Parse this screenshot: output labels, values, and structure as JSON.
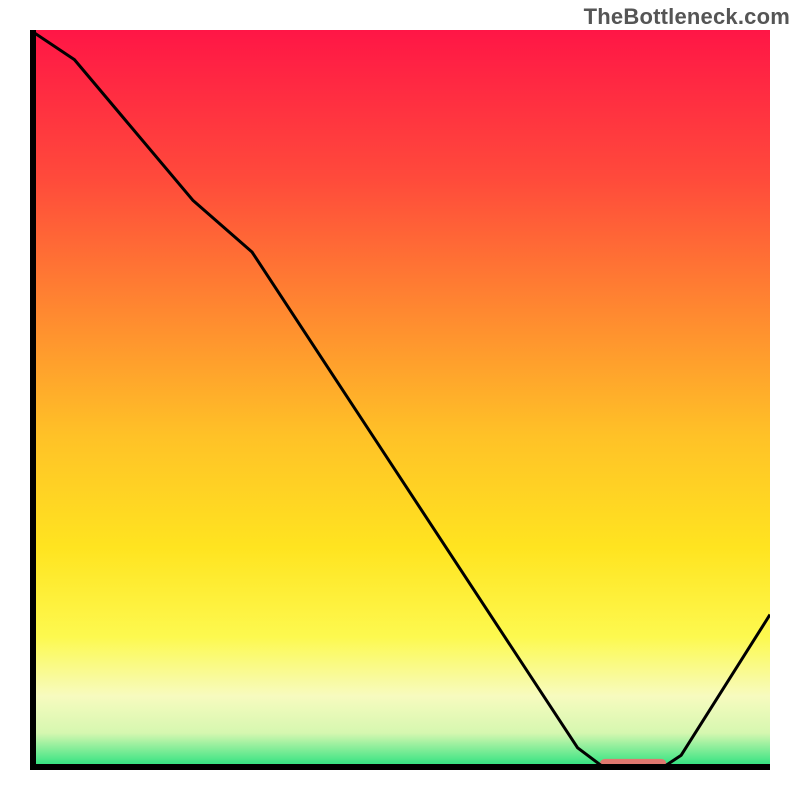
{
  "attribution": "TheBottleneck.com",
  "chart_data": {
    "type": "line",
    "title": "",
    "xlabel": "",
    "ylabel": "",
    "xlim": [
      0,
      100
    ],
    "ylim": [
      0,
      100
    ],
    "grid": false,
    "legend": false,
    "background_gradient": {
      "stops": [
        {
          "offset": 0,
          "color": "#ff1646"
        },
        {
          "offset": 0.2,
          "color": "#ff4a3b"
        },
        {
          "offset": 0.4,
          "color": "#ff8f2f"
        },
        {
          "offset": 0.55,
          "color": "#ffc227"
        },
        {
          "offset": 0.7,
          "color": "#ffe420"
        },
        {
          "offset": 0.82,
          "color": "#fdf94f"
        },
        {
          "offset": 0.9,
          "color": "#f7fbbf"
        },
        {
          "offset": 0.95,
          "color": "#d6f7b0"
        },
        {
          "offset": 1.0,
          "color": "#19e07a"
        }
      ]
    },
    "series": [
      {
        "name": "curve",
        "color": "#000000",
        "x": [
          0,
          6,
          22,
          30,
          74,
          78,
          85,
          88,
          100
        ],
        "values": [
          100,
          96,
          77,
          70,
          3,
          0,
          0,
          2,
          21
        ]
      }
    ],
    "marker": {
      "name": "optimal-range",
      "color": "#e0786f",
      "x_start": 77,
      "x_end": 86,
      "y": 0.8,
      "thickness_pct": 1.4
    },
    "axes": {
      "show_ticks": false,
      "border_color": "#000000",
      "border_width": 6
    }
  }
}
